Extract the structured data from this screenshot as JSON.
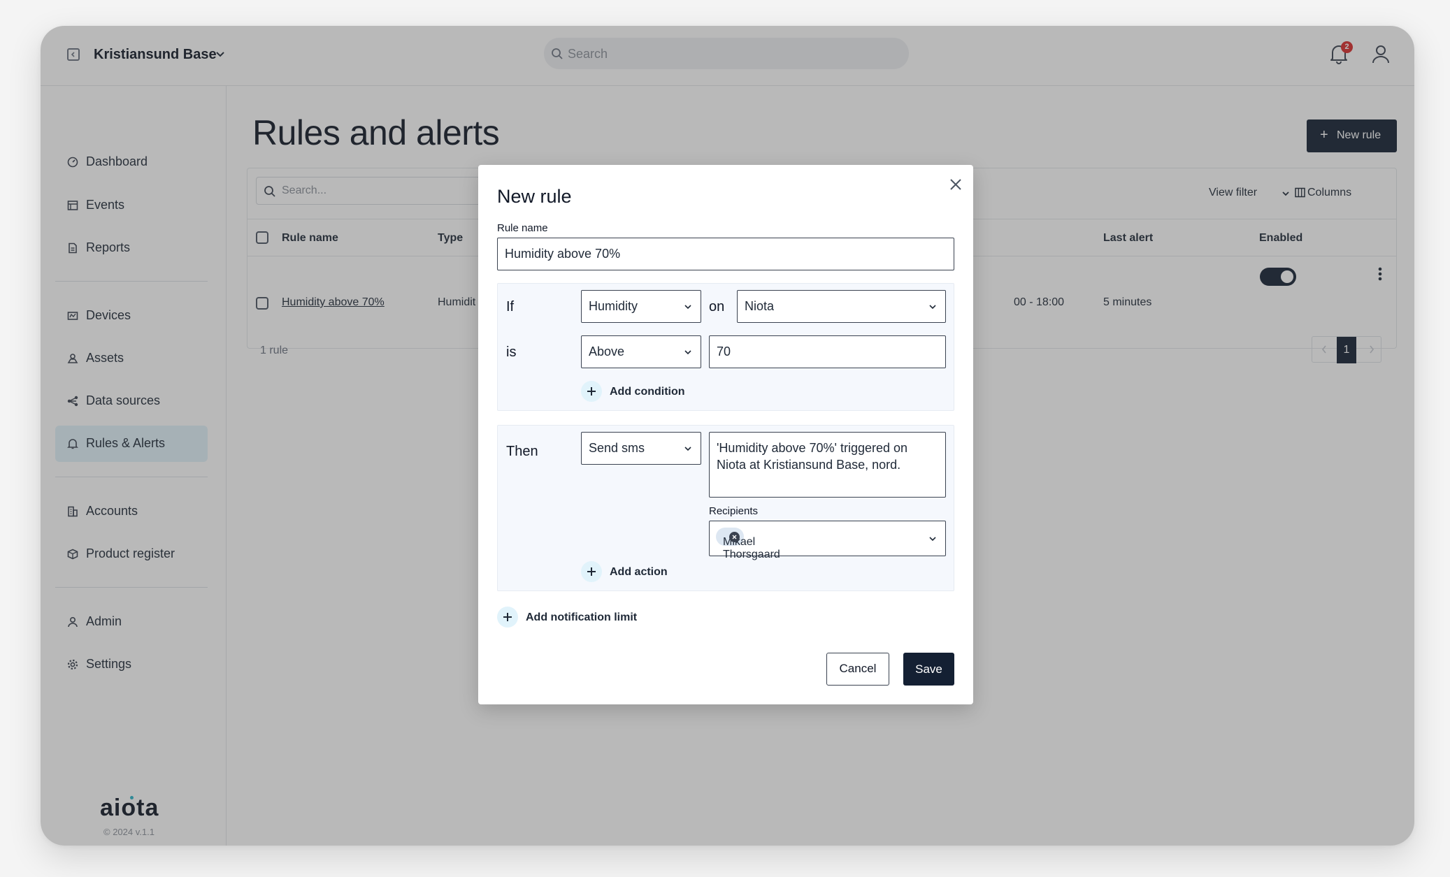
{
  "header": {
    "org_name": "Kristiansund Base",
    "search_placeholder": "Search",
    "notification_count": "2"
  },
  "sidebar": {
    "items": [
      {
        "label": "Dashboard",
        "icon": "gauge-icon"
      },
      {
        "label": "Events",
        "icon": "calendar-icon"
      },
      {
        "label": "Reports",
        "icon": "document-icon"
      },
      {
        "label": "Devices",
        "icon": "devices-icon"
      },
      {
        "label": "Assets",
        "icon": "assets-icon"
      },
      {
        "label": "Data sources",
        "icon": "data-sources-icon"
      },
      {
        "label": "Rules & Alerts",
        "icon": "bell-icon",
        "active": true
      },
      {
        "label": "Accounts",
        "icon": "building-icon"
      },
      {
        "label": "Product register",
        "icon": "box-icon"
      },
      {
        "label": "Admin",
        "icon": "user-icon"
      },
      {
        "label": "Settings",
        "icon": "gear-icon"
      }
    ],
    "logo": "aiota",
    "copyright": "© 2024 v.1.1"
  },
  "main": {
    "title": "Rules and alerts",
    "new_rule_label": "New rule",
    "table_search_placeholder": "Search...",
    "view_filter_label": "View filter",
    "columns_label": "Columns",
    "columns": {
      "rule_name": "Rule name",
      "type": "Type",
      "last_alert": "Last alert",
      "enabled": "Enabled"
    },
    "rows": [
      {
        "rule_name": "Humidity above 70%",
        "type": "Humidit",
        "schedule": "00 - 18:00",
        "last_alert": "5 minutes",
        "enabled": true
      }
    ],
    "rule_count": "1 rule",
    "current_page": "1"
  },
  "modal": {
    "title": "New rule",
    "rule_name_label": "Rule name",
    "rule_name_value": "Humidity above 70%",
    "if_word": "If",
    "metric_value": "Humidity",
    "on_word": "on",
    "device_value": "Niota",
    "is_word": "is",
    "operator_value": "Above",
    "threshold_value": "70",
    "add_condition_label": "Add condition",
    "then_word": "Then",
    "action_value": "Send sms",
    "message_value": "'Humidity above 70%' triggered on Niota at Kristiansund Base, nord.",
    "recipients_label": "Recipients",
    "recipient_chip": "Mikael Thorsgaard",
    "add_action_label": "Add action",
    "add_notification_limit_label": "Add notification limit",
    "cancel_label": "Cancel",
    "save_label": "Save"
  },
  "colors": {
    "primary_dark": "#142033",
    "active_nav": "#e1f3fb",
    "badge_red": "#d92b2b",
    "logo_accent": "#2ab4c9"
  }
}
